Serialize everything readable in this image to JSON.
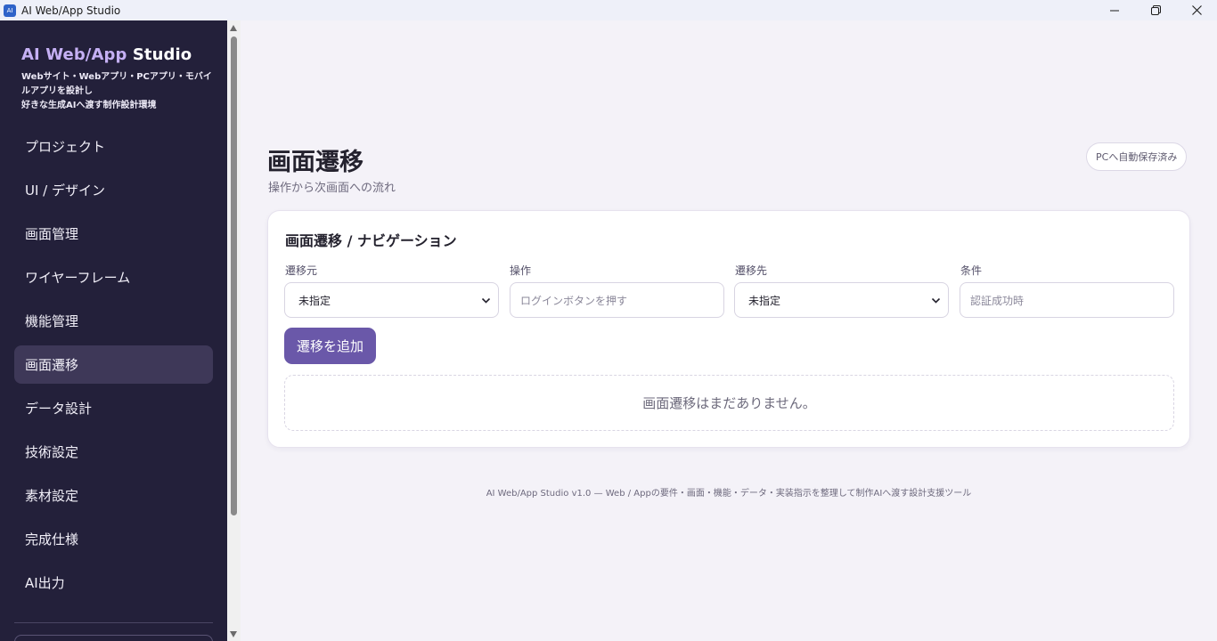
{
  "window": {
    "title": "AI Web/App Studio",
    "app_icon_text": "AI"
  },
  "sidebar": {
    "brand_accent": "AI Web/App",
    "brand_rest": " Studio",
    "tagline_line1": "Webサイト・Webアプリ・PCアプリ・モバイルアプリを設計し",
    "tagline_line2": "好きな生成AIへ渡す制作設計環境",
    "items": [
      {
        "label": "プロジェクト"
      },
      {
        "label": "UI / デザイン"
      },
      {
        "label": "画面管理"
      },
      {
        "label": "ワイヤーフレーム"
      },
      {
        "label": "機能管理"
      },
      {
        "label": "画面遷移",
        "active": true
      },
      {
        "label": "データ設計"
      },
      {
        "label": "技術設定"
      },
      {
        "label": "素材設定"
      },
      {
        "label": "完成仕様"
      },
      {
        "label": "AI出力"
      }
    ]
  },
  "header": {
    "title": "画面遷移",
    "subtitle": "操作から次画面への流れ",
    "autosave": "PCへ自動保存済み"
  },
  "card": {
    "title": "画面遷移 / ナビゲーション",
    "from_label": "遷移元",
    "from_value": "未指定",
    "action_label": "操作",
    "action_placeholder": "ログインボタンを押す",
    "to_label": "遷移先",
    "to_value": "未指定",
    "condition_label": "条件",
    "condition_placeholder": "認証成功時",
    "add_button": "遷移を追加",
    "empty_text": "画面遷移はまだありません。"
  },
  "footer": {
    "text": "AI Web/App Studio v1.0 — Web / Appの要件・画面・機能・データ・実装指示を整理して制作AIへ渡す設計支援ツール"
  },
  "colors": {
    "sidebar_bg": "#23203a",
    "accent": "#6a58a9",
    "brand_accent": "#c5b0f4",
    "page_bg": "#f4f2f8"
  },
  "icons": {
    "minimize": "minimize-icon",
    "restore": "restore-icon",
    "close": "close-icon",
    "select": "chevron-down-icon"
  }
}
